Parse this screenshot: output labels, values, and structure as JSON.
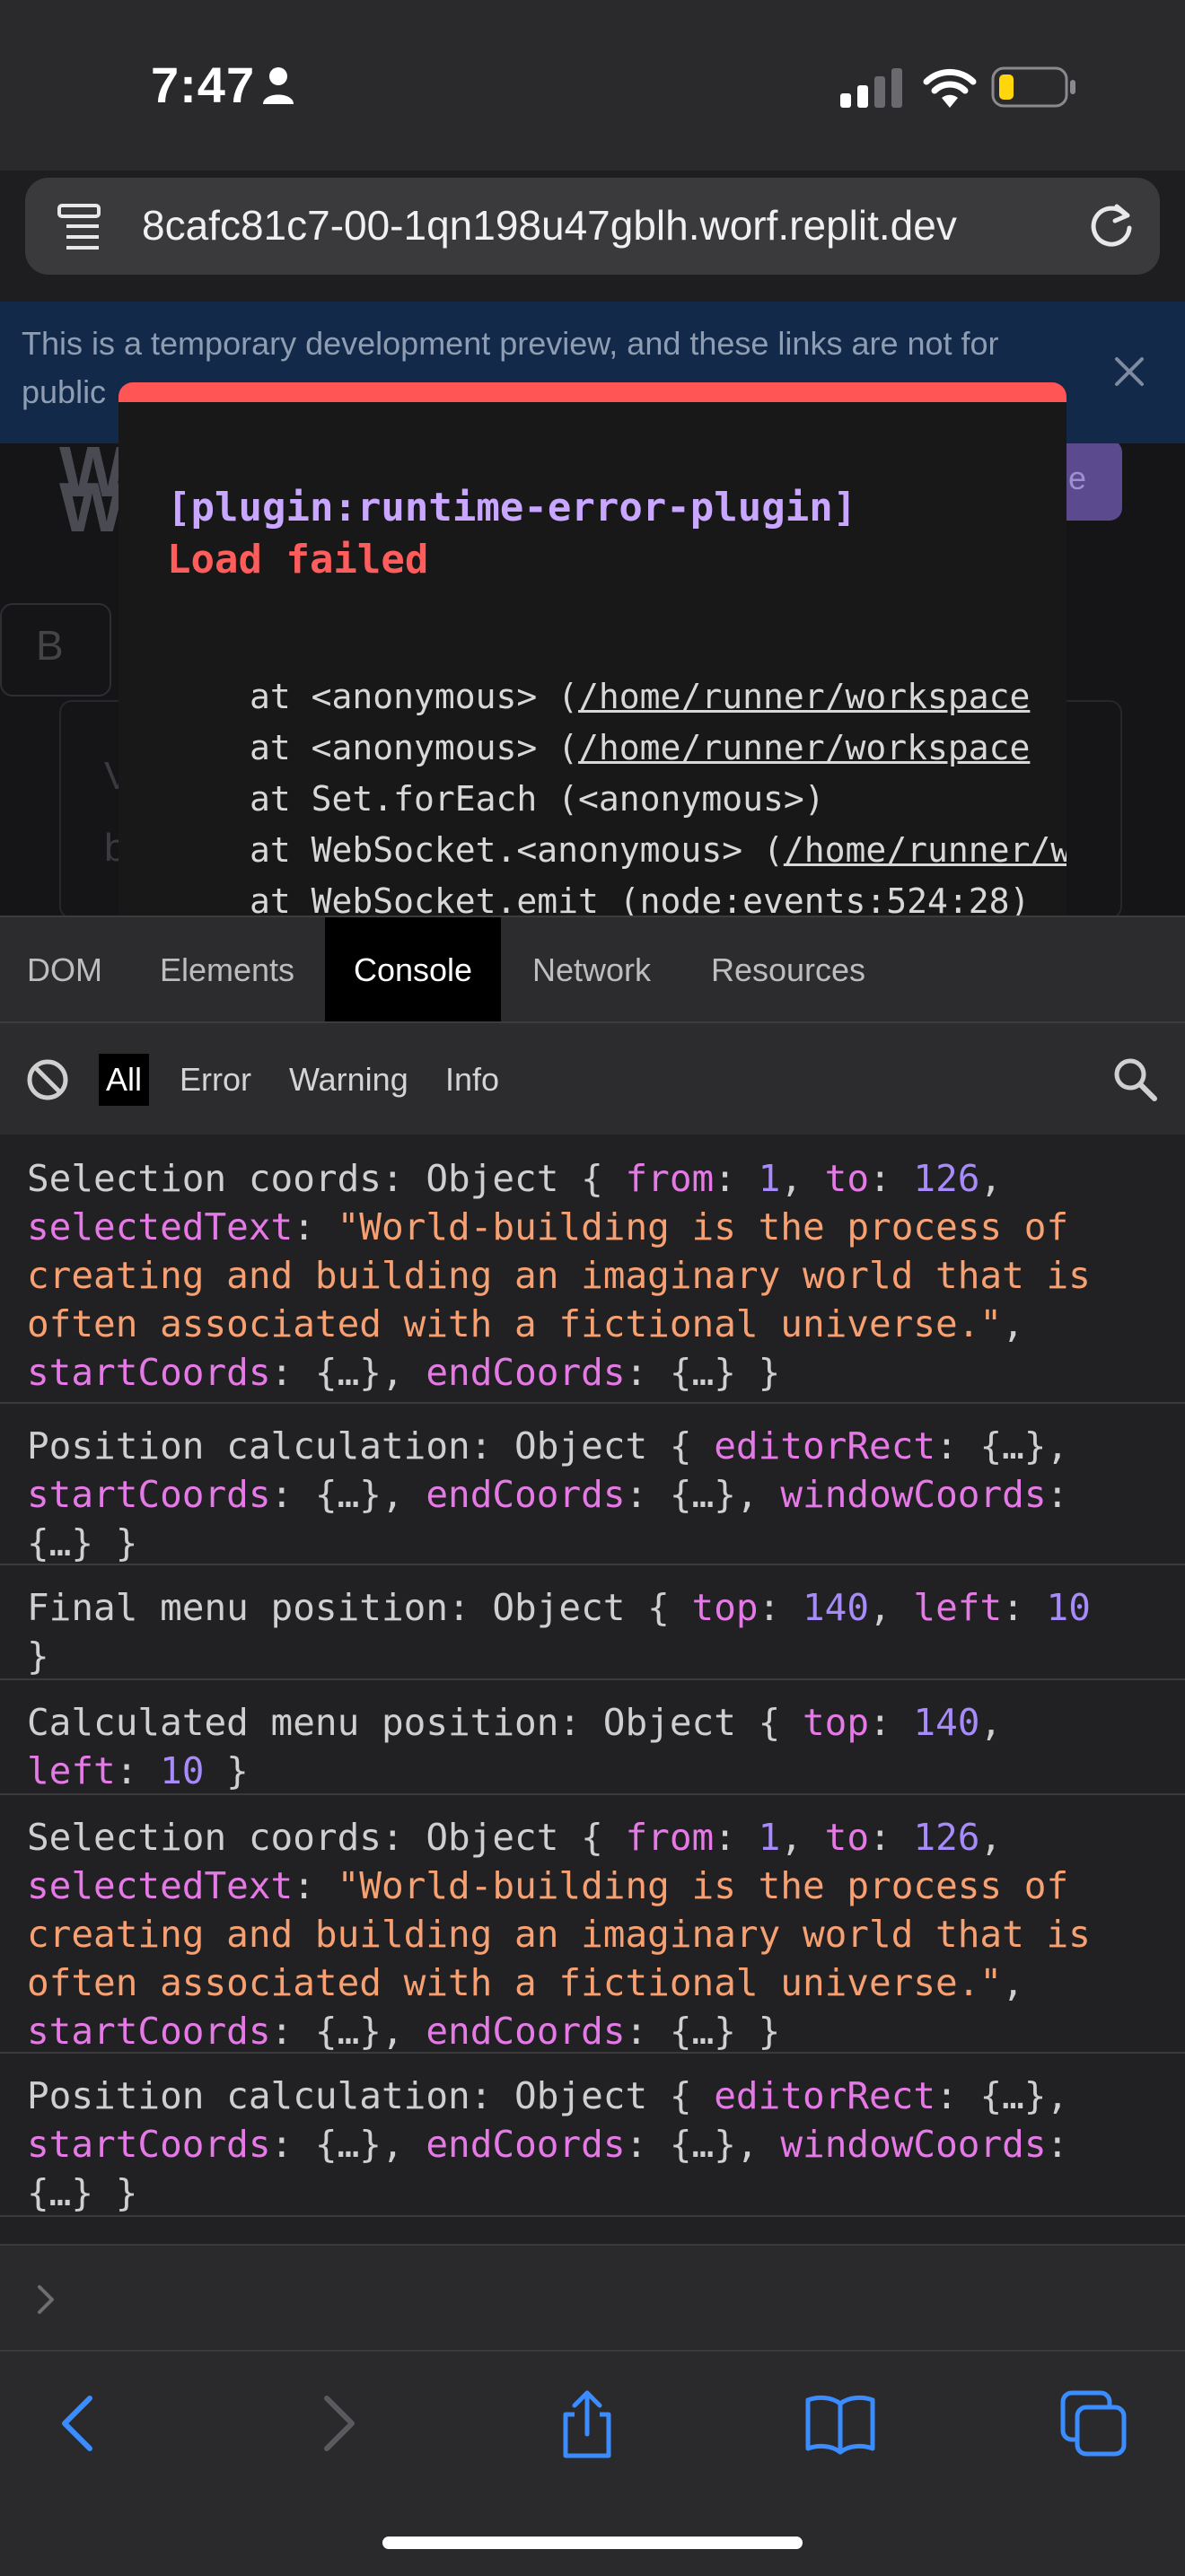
{
  "status_bar": {
    "time": "7:47"
  },
  "url_bar": {
    "url": "8cafc81c7-00-1qn198u47gblh.worf.replit.dev"
  },
  "banner": {
    "text": "This is a temporary development preview, and these links are not for public"
  },
  "background_page": {
    "letters_1": "W",
    "letters_2": "W",
    "button_fragment": "e",
    "box_letter": "B",
    "card_letter_1": "V",
    "card_letter_2": "b"
  },
  "error_overlay": {
    "plugin": "[plugin:runtime-error-plugin]",
    "message": "Load failed",
    "stack": [
      {
        "prefix": "at <anonymous> (",
        "link": "/home/runner/workspace"
      },
      {
        "prefix": "at <anonymous> (",
        "link": "/home/runner/workspace"
      },
      {
        "prefix": "at Set.forEach (<anonymous>)",
        "link": ""
      },
      {
        "prefix": "at WebSocket.<anonymous> (",
        "link": "/home/runner/workspace"
      },
      {
        "prefix": "at WebSocket.emit (node:events:524:28)",
        "link": ""
      }
    ]
  },
  "devtools": {
    "tabs": [
      "DOM",
      "Elements",
      "Console",
      "Network",
      "Resources"
    ],
    "active_tab": "Console",
    "filters": [
      "All",
      "Error",
      "Warning",
      "Info"
    ],
    "active_filter": "All"
  },
  "console_logs": {
    "sel_label": "Selection coords: Object {",
    "pos_label": "Position calculation: Object {",
    "final_label": "Final menu position: Object {",
    "calc_label": "Calculated menu position: Object {",
    "from_key": "from",
    "to_key": "to",
    "from_val": "1",
    "to_val": "126",
    "selected_key": "selectedText",
    "selected_val_1": "\"World-building is the process of",
    "selected_val_2": "creating and building an imaginary world that is",
    "selected_val_3": "often associated with a fictional universe.\"",
    "start_key": "startCoords",
    "end_key": "endCoords",
    "editor_key": "editorRect",
    "window_key": "windowCoords",
    "top_key": "top",
    "left_key": "left",
    "top_val": "140",
    "left_val": "10",
    "ellipsis": "{…}"
  },
  "colors": {
    "error_bar": "#ff5555",
    "key": "#e57ae6",
    "number": "#a78bfa",
    "string": "#f7a072",
    "link_blue": "#2f8cff"
  }
}
